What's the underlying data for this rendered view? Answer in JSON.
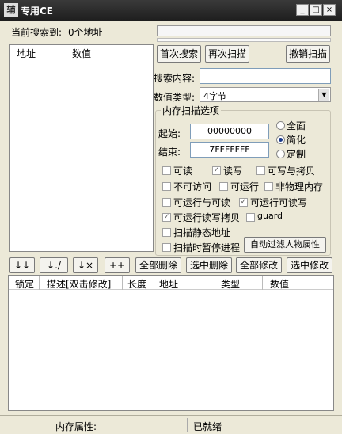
{
  "window": {
    "title": "专用CE",
    "app_icon": "辅"
  },
  "search_status": {
    "label": "当前搜索到:",
    "count": "0个地址"
  },
  "results_list": {
    "col_address": "地址",
    "col_value": "数值"
  },
  "buttons": {
    "first_scan": "首次搜索",
    "next_scan": "再次扫描",
    "undo_scan": "撤销扫描"
  },
  "search_content": {
    "label": "搜索内容:",
    "value": ""
  },
  "value_type": {
    "label": "数值类型:",
    "selected": "4字节"
  },
  "mem_options": {
    "title": "内存扫描选项",
    "start_label": "起始:",
    "start_value": "00000000",
    "end_label": "结束:",
    "end_value": "7FFFFFFF",
    "radio_full": "全面",
    "radio_simple": "简化",
    "radio_custom": "定制",
    "read": "可读",
    "write": "读写",
    "copy_write": "可写与拷贝",
    "no_access": "不可访问",
    "executable": "可运行",
    "non_physical": "非物理内存",
    "exec_read": "可运行与可读",
    "exec_write": "可运行可读写",
    "exec_rw_copy": "可运行读写拷贝",
    "guard": "guard",
    "static_only": "扫描静态地址",
    "pause_scan": "扫描时暂停进程",
    "auto_filter": "自动过滤人物属性"
  },
  "toolbar": {
    "down_all": "↓↓",
    "down_check": "↓./",
    "down_x": "↓×",
    "plus": "++",
    "delete_all": "全部删除",
    "delete_sel": "选中删除",
    "edit_all": "全部修改",
    "edit_sel": "选中修改"
  },
  "address_table": {
    "col_lock": "锁定",
    "col_desc": "描述[双击修改]",
    "col_len": "长度",
    "col_addr": "地址",
    "col_type": "类型",
    "col_value": "数值"
  },
  "status_bar": {
    "mem_attr": "内存属性:",
    "state": "已就绪"
  }
}
